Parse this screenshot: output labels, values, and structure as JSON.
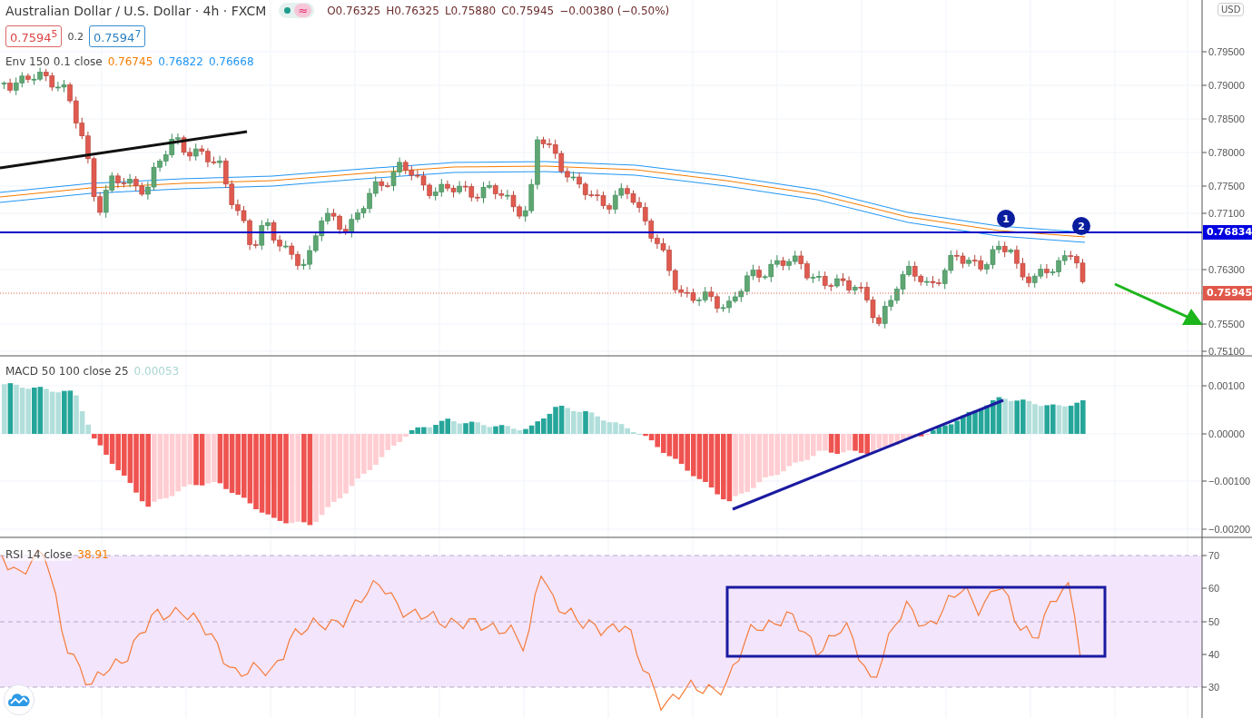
{
  "header": {
    "title": "Australian Dollar / U.S. Dollar · 4h · FXCM",
    "status_symbol": "≈",
    "ohlc": [
      {
        "label": "O",
        "value": "0.76325"
      },
      {
        "label": "H",
        "value": "0.76325"
      },
      {
        "label": "L",
        "value": "0.75880"
      },
      {
        "label": "C",
        "value": "0.75945"
      }
    ],
    "change": "−0.00380 (−0.50%)"
  },
  "trade": {
    "sell": "0.7594$^{5}$",
    "spread": "0.2",
    "buy": "0.7594$^{7}$"
  },
  "envelope_legend": {
    "label": "Env 150 0.1 close",
    "values": [
      {
        "text": "0.76745",
        "color": "#f57c00"
      },
      {
        "text": "0.76822",
        "color": "#2196f3"
      },
      {
        "text": "0.76668",
        "color": "#2196f3"
      }
    ]
  },
  "price_axis": {
    "currency": "USD",
    "ticks": [
      "0.79500",
      "0.79000",
      "0.78500",
      "0.78000",
      "0.77500",
      "0.77100",
      "0.76300",
      "0.75500",
      "0.75100"
    ],
    "tags": [
      {
        "text": "0.76834",
        "color": "#0000e0"
      },
      {
        "text": "0.75945",
        "color": "#e0584a"
      }
    ]
  },
  "markers": [
    "1",
    "2"
  ],
  "macd": {
    "label": "MACD 50 100 close 25",
    "value": "0.00053",
    "ticks": [
      "0.00100",
      "0.00000",
      "−0.00100",
      "−0.00200"
    ]
  },
  "rsi": {
    "label": "RSI 14 close",
    "value": "38.91",
    "ticks": [
      "70",
      "60",
      "50",
      "40",
      "30"
    ]
  }
}
